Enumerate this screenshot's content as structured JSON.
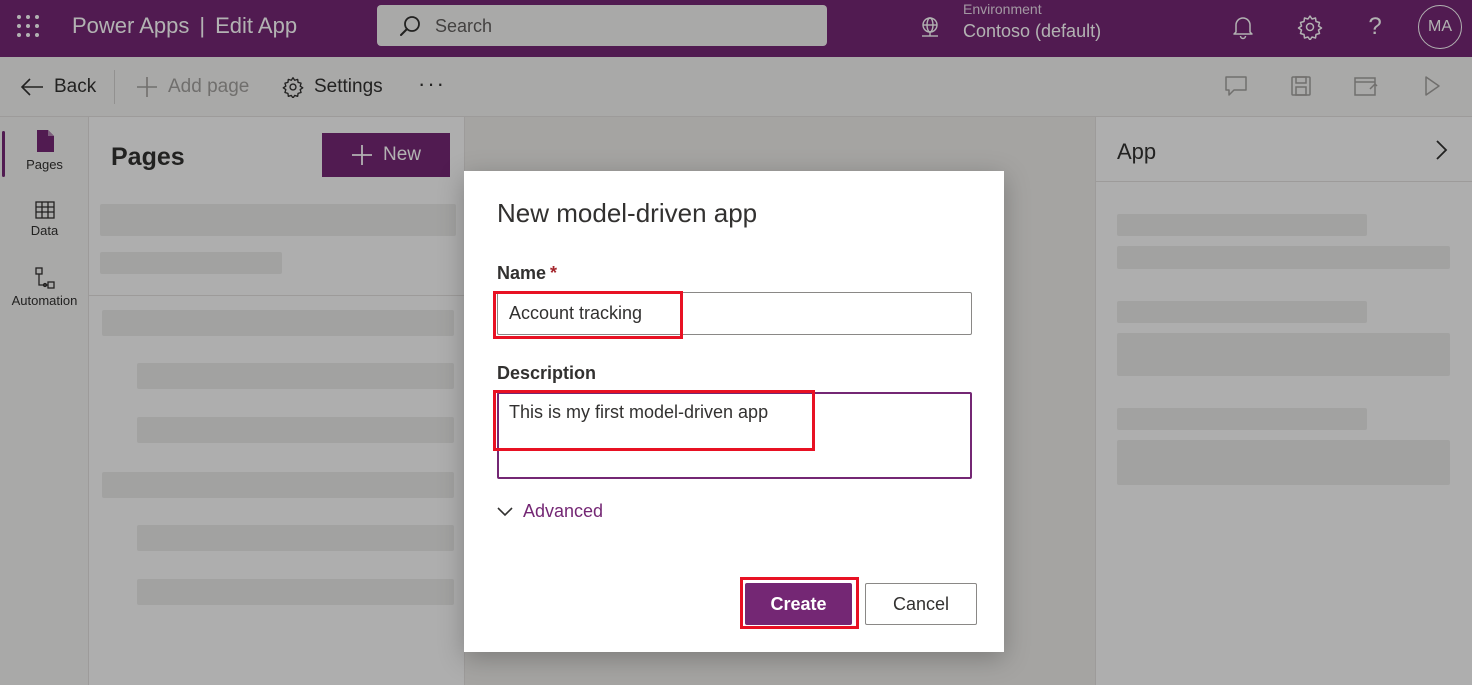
{
  "header": {
    "product": "Power Apps",
    "separator": "|",
    "page": "Edit App",
    "search_placeholder": "Search",
    "environment_label": "Environment",
    "environment_value": "Contoso (default)",
    "avatar_initials": "MA",
    "help_glyph": "?",
    "icons": [
      "waffle-icon",
      "search-icon",
      "globe-icon",
      "bell-icon",
      "gear-icon",
      "help-icon"
    ]
  },
  "commandbar": {
    "back": "Back",
    "add_page": "Add page",
    "settings": "Settings",
    "more": "···",
    "right_tools": [
      "comment-icon",
      "save-icon",
      "publish-icon",
      "play-icon"
    ]
  },
  "rail": {
    "items": [
      {
        "label": "Pages",
        "icon": "page-icon"
      },
      {
        "label": "Data",
        "icon": "table-icon"
      },
      {
        "label": "Automation",
        "icon": "flow-icon"
      }
    ]
  },
  "pages_panel": {
    "title": "Pages",
    "new_button": "New"
  },
  "right_pane": {
    "title": "App"
  },
  "dialog": {
    "title": "New model-driven app",
    "name_label": "Name",
    "required_mark": "*",
    "name_value": "Account tracking",
    "description_label": "Description",
    "description_value": "This is my first model-driven app",
    "advanced_label": "Advanced",
    "create_button": "Create",
    "cancel_button": "Cancel"
  },
  "colors": {
    "brand": "#742774",
    "highlight": "#e81123"
  }
}
